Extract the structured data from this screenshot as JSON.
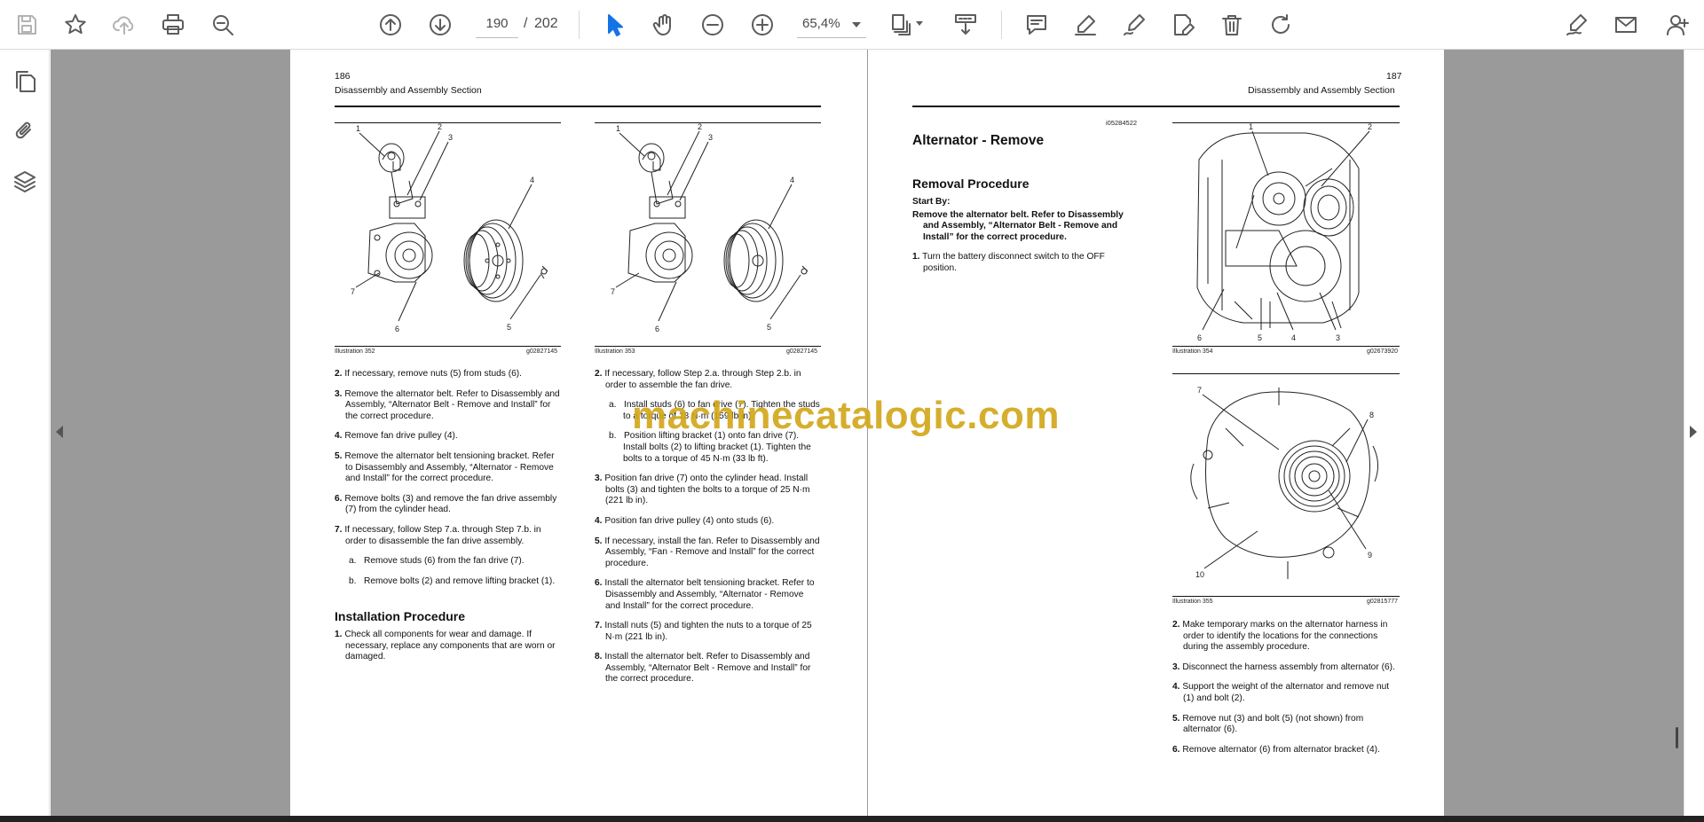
{
  "toolbar": {
    "page_current": "190",
    "page_separator": "/",
    "page_total": "202",
    "zoom": "65,4%"
  },
  "left_page": {
    "number": "186",
    "header": "Disassembly and Assembly Section",
    "fig1": {
      "caption_left": "Illustration 352",
      "caption_right": "g02827145",
      "labels": [
        "1",
        "2",
        "3",
        "4",
        "5",
        "6",
        "7"
      ]
    },
    "fig2": {
      "caption_left": "Illustration 353",
      "caption_right": "g02827145",
      "labels": [
        "1",
        "2",
        "3",
        "4",
        "5",
        "6",
        "7"
      ]
    },
    "col1_steps": [
      {
        "n": "2.",
        "t": "If necessary, remove nuts (5) from studs (6)."
      },
      {
        "n": "3.",
        "t": "Remove the alternator belt. Refer to Disassembly and Assembly, “Alternator Belt - Remove and Install” for the correct procedure."
      },
      {
        "n": "4.",
        "t": "Remove fan drive pulley (4)."
      },
      {
        "n": "5.",
        "t": "Remove the alternator belt tensioning bracket. Refer to Disassembly and Assembly, “Alternator - Remove and Install” for the correct procedure."
      },
      {
        "n": "6.",
        "t": "Remove bolts (3) and remove the fan drive assembly (7) from the cylinder head."
      },
      {
        "n": "7.",
        "t": "If necessary, follow Step 7.a. through Step 7.b. in order to disassemble the fan drive assembly."
      }
    ],
    "col1_substeps": [
      {
        "n": "a.",
        "t": "Remove studs (6) from the fan drive (7)."
      },
      {
        "n": "b.",
        "t": "Remove bolts (2) and remove lifting bracket (1)."
      }
    ],
    "install_heading": "Installation Procedure",
    "install_steps": [
      {
        "n": "1.",
        "t": "Check all components for wear and damage. If necessary, replace any components that are worn or damaged."
      }
    ],
    "col2_step_intro": {
      "n": "2.",
      "t": "If necessary, follow Step 2.a. through Step 2.b. in order to assemble the fan drive."
    },
    "col2_substeps": [
      {
        "n": "a.",
        "t": "Install studs (6) to fan drive (7). Tighten the studs to a torque of 18 N·m (159 lb in)."
      },
      {
        "n": "b.",
        "t": "Position lifting bracket (1) onto fan drive (7). Install bolts (2) to lifting bracket (1). Tighten the bolts to a torque of 45 N·m (33 lb ft)."
      }
    ],
    "col2_steps": [
      {
        "n": "3.",
        "t": "Position fan drive (7) onto the cylinder head. Install bolts (3) and tighten the bolts to a torque of 25 N·m (221 lb in)."
      },
      {
        "n": "4.",
        "t": "Position fan drive pulley (4) onto studs (6)."
      },
      {
        "n": "5.",
        "t": "If necessary, install the fan. Refer to Disassembly and Assembly, “Fan - Remove and Install” for the correct procedure."
      },
      {
        "n": "6.",
        "t": "Install the alternator belt tensioning bracket. Refer to Disassembly and Assembly, “Alternator - Remove and Install” for the correct procedure."
      },
      {
        "n": "7.",
        "t": "Install nuts (5) and tighten the nuts to a torque of 25 N·m (221 lb in)."
      },
      {
        "n": "8.",
        "t": "Install the alternator belt. Refer to Disassembly and Assembly, “Alternator Belt - Remove and Install” for the correct procedure."
      }
    ]
  },
  "right_page": {
    "number": "187",
    "header": "Disassembly and Assembly Section",
    "doc_id": "i05284522",
    "title": "Alternator - Remove",
    "removal_heading": "Removal Procedure",
    "start_by": "Start By:",
    "start_by_text": "Remove the alternator belt. Refer to Disassembly and Assembly, “Alternator Belt - Remove and Install” for the correct procedure.",
    "step1": {
      "n": "1.",
      "t": "Turn the battery disconnect switch to the OFF position."
    },
    "fig3": {
      "caption_left": "Illustration 354",
      "caption_right": "g02673920",
      "labels": [
        "1",
        "2",
        "6",
        "5",
        "4",
        "3"
      ]
    },
    "fig4": {
      "caption_left": "Illustration 355",
      "caption_right": "g02815777",
      "labels": [
        "7",
        "8",
        "9",
        "10"
      ]
    },
    "steps": [
      {
        "n": "2.",
        "t": "Make temporary marks on the alternator harness in order to identify the locations for the connections during the assembly procedure."
      },
      {
        "n": "3.",
        "t": "Disconnect the harness assembly from alternator (6)."
      },
      {
        "n": "4.",
        "t": "Support the weight of the alternator and remove nut (1) and bolt (2)."
      },
      {
        "n": "5.",
        "t": "Remove nut (3) and bolt (5) (not shown) from alternator (6)."
      },
      {
        "n": "6.",
        "t": "Remove alternator (6) from alternator bracket (4)."
      }
    ]
  },
  "watermark": "machinecatalogic.com"
}
